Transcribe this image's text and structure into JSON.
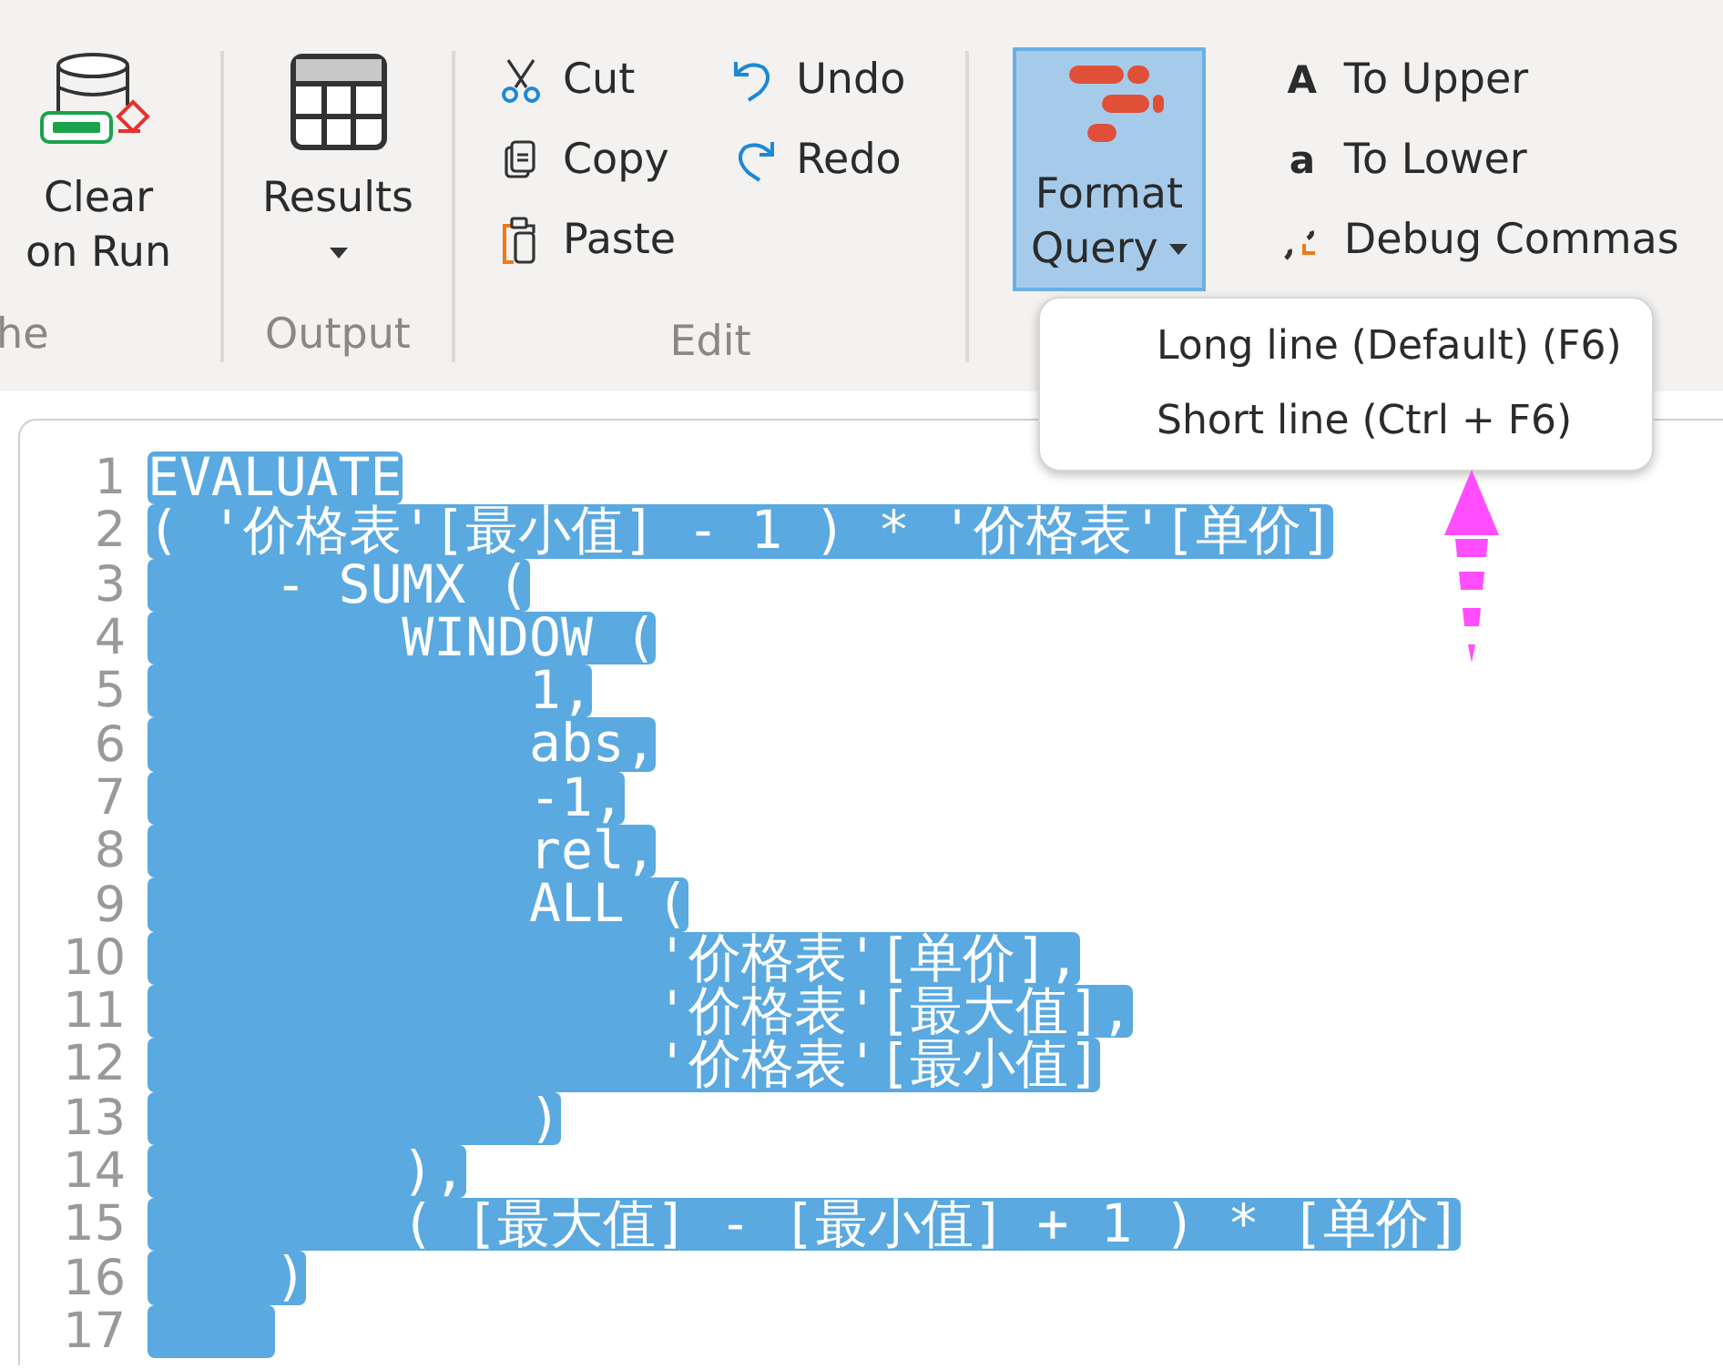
{
  "ribbon": {
    "groups": [
      {
        "label": "he",
        "large": [
          {
            "lines": [
              "Clear",
              "on Run"
            ],
            "dropdown": false,
            "selected": false
          }
        ]
      },
      {
        "label": "Output",
        "large": [
          {
            "lines": [
              "Results"
            ],
            "dropdown": true,
            "selected": false
          }
        ]
      },
      {
        "label": "Edit",
        "small_columns": [
          [
            {
              "label": "Cut"
            },
            {
              "label": "Copy"
            },
            {
              "label": "Paste"
            }
          ],
          [
            {
              "label": "Undo"
            },
            {
              "label": "Redo"
            }
          ]
        ]
      },
      {
        "large": [
          {
            "lines": [
              "Format",
              "Query"
            ],
            "dropdown": true,
            "selected": true
          }
        ],
        "small_columns": [
          [
            {
              "glyph": "A",
              "label": "To Upper"
            },
            {
              "glyph": "a",
              "label": "To Lower"
            },
            {
              "label": "Debug Commas"
            }
          ]
        ]
      }
    ]
  },
  "format_menu": {
    "items": [
      "Long line (Default) (F6)",
      "Short line (Ctrl + F6)"
    ]
  },
  "editor": {
    "lines": [
      {
        "number": "1",
        "text": "EVALUATE",
        "selected": true
      },
      {
        "number": "2",
        "text": "( '价格表'[最小值] - 1 ) * '价格表'[单价]",
        "selected": true
      },
      {
        "number": "3",
        "text": "    - SUMX (",
        "selected": true
      },
      {
        "number": "4",
        "text": "        WINDOW (",
        "selected": true
      },
      {
        "number": "5",
        "text": "            1,",
        "selected": true
      },
      {
        "number": "6",
        "text": "            abs,",
        "selected": true
      },
      {
        "number": "7",
        "text": "            -1,",
        "selected": true
      },
      {
        "number": "8",
        "text": "            rel,",
        "selected": true
      },
      {
        "number": "9",
        "text": "            ALL (",
        "selected": true
      },
      {
        "number": "10",
        "text": "                '价格表'[单价],",
        "selected": true
      },
      {
        "number": "11",
        "text": "                '价格表'[最大值],",
        "selected": true
      },
      {
        "number": "12",
        "text": "                '价格表'[最小值]",
        "selected": true
      },
      {
        "number": "13",
        "text": "            )",
        "selected": true
      },
      {
        "number": "14",
        "text": "        ),",
        "selected": true
      },
      {
        "number": "15",
        "text": "        ( [最大值] - [最小值] + 1 ) * [单价]",
        "selected": true
      },
      {
        "number": "16",
        "text": "    )",
        "selected": true
      },
      {
        "number": "17",
        "selected": true
      }
    ]
  }
}
